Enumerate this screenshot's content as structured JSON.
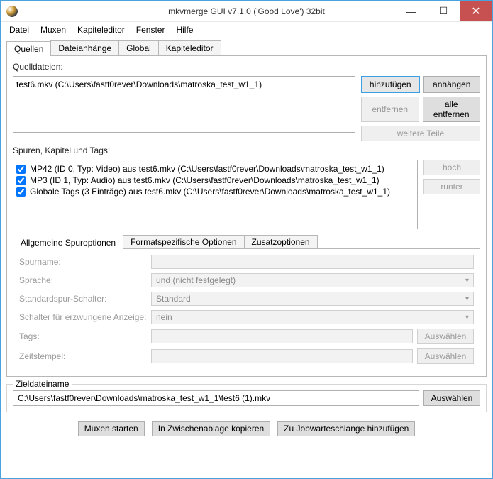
{
  "window": {
    "title": "mkvmerge GUI v7.1.0 ('Good Love') 32bit"
  },
  "menu": [
    "Datei",
    "Muxen",
    "Kapiteleditor",
    "Fenster",
    "Hilfe"
  ],
  "mainTabs": [
    "Quellen",
    "Dateianhänge",
    "Global",
    "Kapiteleditor"
  ],
  "sourceLabel": "Quelldateien:",
  "sourceFiles": [
    "test6.mkv (C:\\Users\\fastf0rever\\Downloads\\matroska_test_w1_1)"
  ],
  "sideButtons": {
    "add": "hinzufügen",
    "append": "anhängen",
    "remove": "entfernen",
    "removeAll": "alle entfernen",
    "moreParts": "weitere Teile"
  },
  "tracksLabel": "Spuren, Kapitel und Tags:",
  "tracks": [
    "MP42 (ID 0, Typ: Video) aus test6.mkv (C:\\Users\\fastf0rever\\Downloads\\matroska_test_w1_1)",
    "MP3 (ID 1, Typ: Audio) aus test6.mkv (C:\\Users\\fastf0rever\\Downloads\\matroska_test_w1_1)",
    "Globale Tags (3 Einträge) aus test6.mkv (C:\\Users\\fastf0rever\\Downloads\\matroska_test_w1_1)"
  ],
  "trackSide": {
    "up": "hoch",
    "down": "runter"
  },
  "innerTabs": [
    "Allgemeine Spuroptionen",
    "Formatspezifische Optionen",
    "Zusatzoptionen"
  ],
  "form": {
    "trackName": {
      "label": "Spurname:",
      "value": ""
    },
    "language": {
      "label": "Sprache:",
      "value": "und (nicht festgelegt)"
    },
    "defaultFlag": {
      "label": "Standardspur-Schalter:",
      "value": "Standard"
    },
    "forcedFlag": {
      "label": "Schalter für erzwungene Anzeige:",
      "value": "nein"
    },
    "tags": {
      "label": "Tags:",
      "value": "",
      "btn": "Auswählen"
    },
    "timestamps": {
      "label": "Zeitstempel:",
      "value": "",
      "btn": "Auswählen"
    }
  },
  "dest": {
    "legend": "Zieldateiname",
    "value": "C:\\Users\\fastf0rever\\Downloads\\matroska_test_w1_1\\test6 (1).mkv",
    "btn": "Auswählen"
  },
  "bottom": {
    "start": "Muxen starten",
    "copy": "In Zwischenablage kopieren",
    "queue": "Zu Jobwarteschlange hinzufügen"
  }
}
